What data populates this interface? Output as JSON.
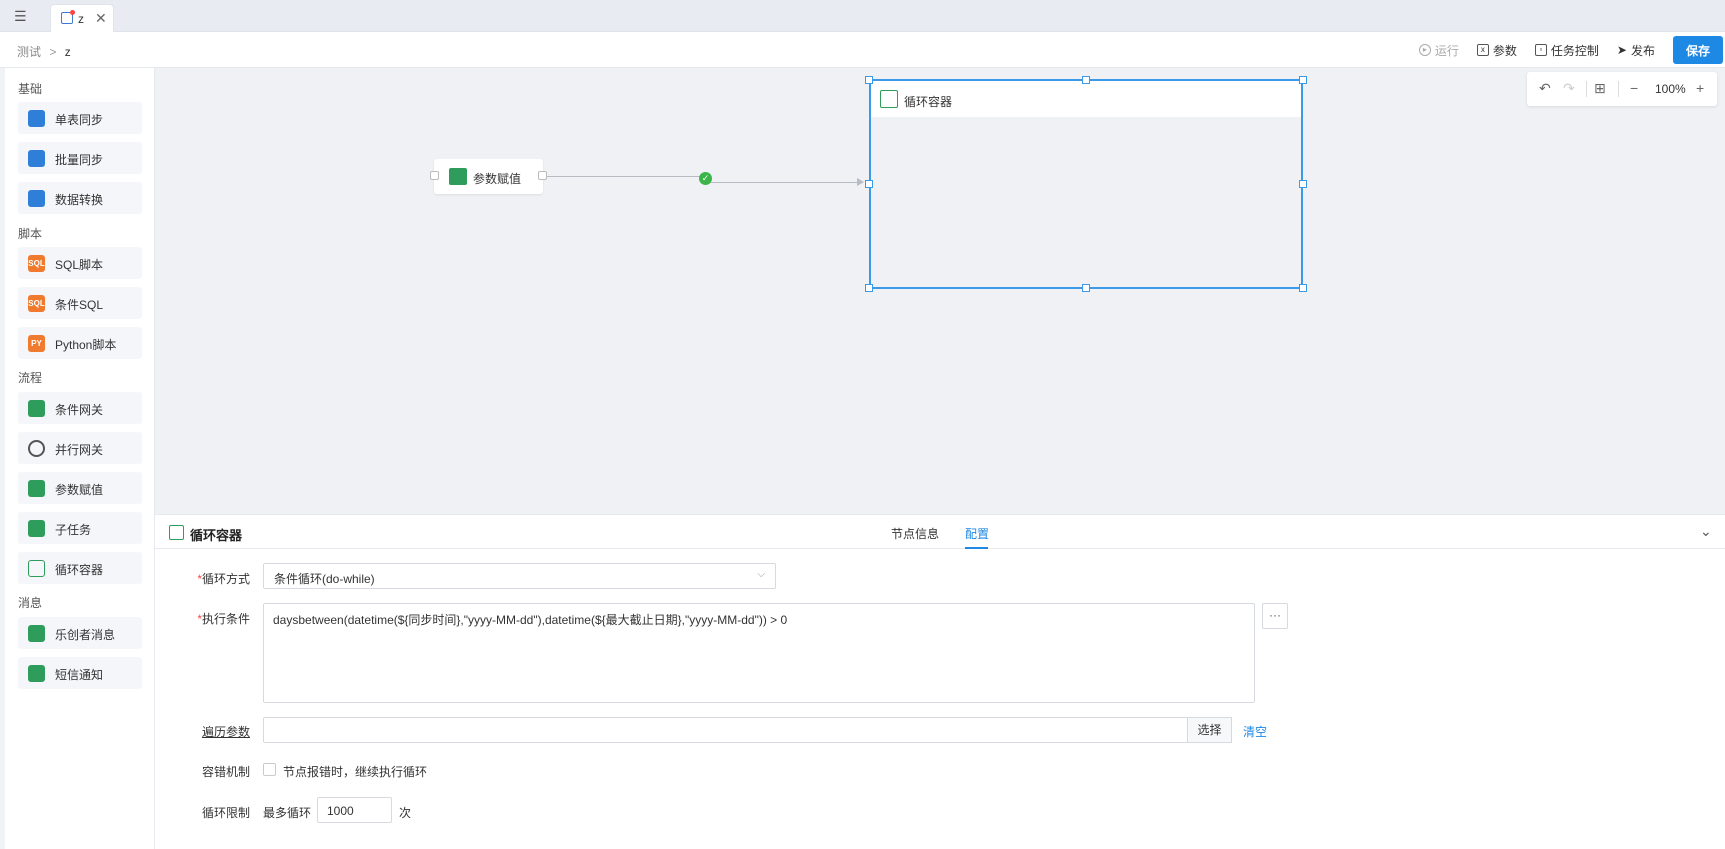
{
  "tab": {
    "label": "z",
    "close": "✕"
  },
  "breadcrumb": {
    "parent": "测试",
    "separator": ">",
    "current": "z"
  },
  "toolbar": {
    "run_label": "运行",
    "params_label": "参数",
    "task_control_label": "任务控制",
    "publish_label": "发布",
    "save_label": "保存"
  },
  "sidebar": {
    "groups": [
      {
        "title": "基础",
        "items": [
          "单表同步",
          "批量同步",
          "数据转换"
        ]
      },
      {
        "title": "脚本",
        "items": [
          "SQL脚本",
          "条件SQL",
          "Python脚本"
        ]
      },
      {
        "title": "流程",
        "items": [
          "条件网关",
          "并行网关",
          "参数赋值",
          "子任务",
          "循环容器"
        ]
      },
      {
        "title": "消息",
        "items": [
          "乐创者消息",
          "短信通知"
        ]
      }
    ],
    "icon_texts": {
      "sql": "SQL",
      "py": "PY"
    }
  },
  "canvas": {
    "zoom": "100%",
    "zoom_controls": {
      "undo": "↶",
      "redo": "↷",
      "fit": "⊞",
      "zoom_out": "−",
      "zoom_in": "+"
    },
    "nodes": {
      "param_node": "参数赋值",
      "loop_container": "循环容器"
    },
    "edge_status": "success"
  },
  "panel": {
    "title": "循环容器",
    "tabs": [
      "节点信息",
      "配置"
    ],
    "active_tab": "配置",
    "fields": {
      "loop_mode_label": "循环方式",
      "loop_mode_value": "条件循环(do-while)",
      "exec_cond_label": "执行条件",
      "exec_cond_value": "daysbetween(datetime(${同步时间},\"yyyy-MM-dd\"),datetime(${最大截止日期},\"yyyy-MM-dd\")) > 0",
      "more_button": "···",
      "iter_param_label": "遍历参数",
      "iter_param_value": "",
      "select_button": "选择",
      "clear_link": "清空",
      "fault_label": "容错机制",
      "fault_checkbox_label": "节点报错时，继续执行循环",
      "fault_checked": false,
      "limit_label": "循环限制",
      "max_loops_label": "最多循环",
      "max_loops_value": "1000",
      "times_label": "次"
    }
  },
  "colors": {
    "accent": "#1e88e5",
    "selection": "#3a9ae8",
    "success": "#3bb54a",
    "required": "#ff4444"
  }
}
